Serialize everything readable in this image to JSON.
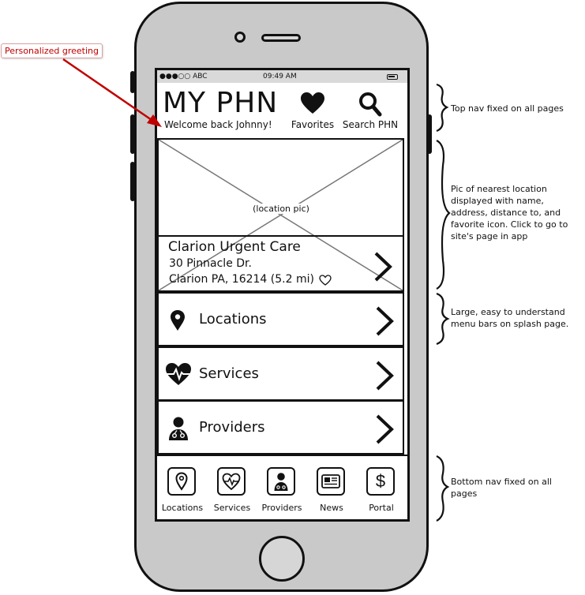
{
  "status_bar": {
    "carrier": "●●●○○ ABC",
    "time": "09:49 AM"
  },
  "header": {
    "logo": "MY PHN",
    "greeting": "Welcome back Johnny!",
    "favorites_label": "Favorites",
    "search_label": "Search PHN"
  },
  "hero": {
    "image_placeholder": "(location pic)",
    "name": "Clarion Urgent Care",
    "address_line1": "30 Pinnacle Dr.",
    "address_line2": "Clarion PA, 16214 (5.2 mi)",
    "favorite_icon": "heart-outline-icon"
  },
  "menu": {
    "items": [
      {
        "label": "Locations",
        "icon": "map-pin-icon"
      },
      {
        "label": "Services",
        "icon": "heartbeat-icon"
      },
      {
        "label": "Providers",
        "icon": "doctor-icon"
      }
    ]
  },
  "bottom_nav": {
    "items": [
      {
        "label": "Locations",
        "icon": "map-pin-icon"
      },
      {
        "label": "Services",
        "icon": "heartbeat-icon"
      },
      {
        "label": "Providers",
        "icon": "doctor-icon"
      },
      {
        "label": "News",
        "icon": "newspaper-icon"
      },
      {
        "label": "Portal",
        "icon": "dollar-icon"
      }
    ]
  },
  "annotations": {
    "greeting_tag": "Personalized greeting",
    "top_nav": "Top nav fixed on all pages",
    "hero_lines": [
      "Pic of nearest location",
      "displayed with name,",
      "address, distance to, and",
      "favorite icon. Click to go to",
      "site's page in app"
    ],
    "menu_lines": [
      "Large, easy to understand",
      "menu bars on splash page."
    ],
    "bottom_nav_lines": [
      "Bottom nav fixed on all",
      "pages"
    ]
  },
  "colors": {
    "annotation_arrow": "#c00000",
    "phone_body": "#c9c9c9",
    "status_bar": "#d9d9d9"
  }
}
